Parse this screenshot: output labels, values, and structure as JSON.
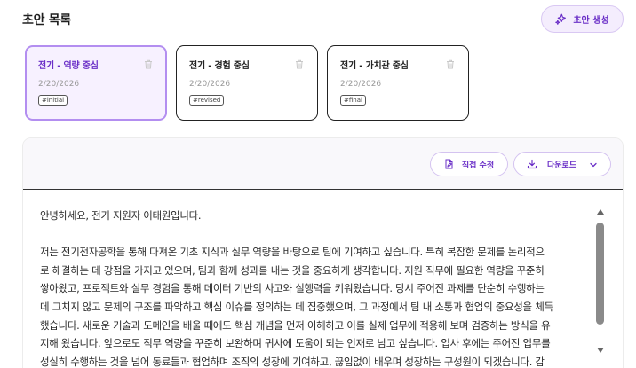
{
  "header": {
    "title": "초안 목록",
    "generate_label": "초안 생성"
  },
  "drafts": [
    {
      "title": "전기 - 역량 중심",
      "date": "2/20/2026",
      "tag": "#initial",
      "selected": true
    },
    {
      "title": "전기 - 경험 중심",
      "date": "2/20/2026",
      "tag": "#revised",
      "selected": false
    },
    {
      "title": "전기 - 가치관 중심",
      "date": "2/20/2026",
      "tag": "#final",
      "selected": false
    }
  ],
  "toolbar": {
    "edit_label": "직접 수정",
    "download_label": "다운로드"
  },
  "content": {
    "greeting": "안녕하세요, 전기 지원자 이태원입니다.",
    "lines": [
      "저는 전기전자공학을 통해 다져온 기초 지식과 실무 역량을 바탕으로 팀에 기여하고 싶습니다. 특히 복잡한 문제를 논리적으",
      "로 해결하는 데 강점을 가지고 있으며, 팀과 함께 성과를 내는 것을 중요하게 생각합니다. 지원 직무에 필요한 역량을 꾸준히",
      "쌓아왔고, 프로젝트와 실무 경험을 통해 데이터 기반의 사고와 실행력을 키워왔습니다. 당시 주어진 과제를 단순히 수행하는",
      "데 그치지 않고 문제의 구조를 파악하고 핵심 이슈를 정의하는 데 집중했으며, 그 과정에서 팀 내 소통과 협업의 중요성을 체득",
      "했습니다. 새로운 기술과 도메인을 배울 때에도 핵심 개념을 먼저 이해하고 이를 실제 업무에 적용해 보며 검증하는 방식을 유",
      "지해 왔습니다. 앞으로도 직무 역량을 꾸준히 보완하며 귀사에 도움이 되는 인재로 남고 싶습니다. 입사 후에는 주어진 업무를",
      "성실히 수행하는 것을 넘어 동료들과 협업하며 조직의 성장에 기여하고, 끊임없이 배우며 성장하는 구성원이 되겠습니다. 감"
    ]
  },
  "colors": {
    "accent": "#6a2fc7",
    "accent_border": "#b38ef0",
    "accent_bg": "#f7f1ff"
  },
  "icons": {
    "generate": "sparkle-icon",
    "delete": "trash-icon",
    "edit": "file-edit-icon",
    "download": "download-icon",
    "dropdown": "chevron-down-icon"
  }
}
